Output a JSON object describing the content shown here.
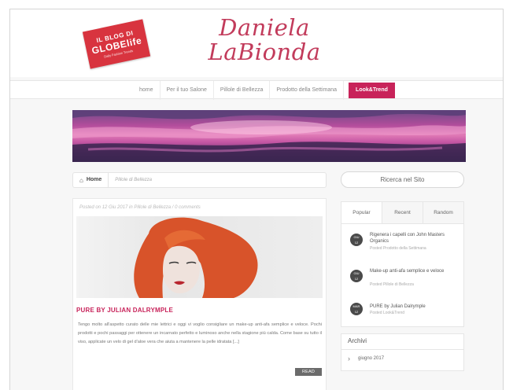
{
  "header": {
    "logo": {
      "line1": "IL BLOG DI",
      "line2": "GLOBElife",
      "line3": "Daily Fashion Trends"
    },
    "title_line1": "Daniela",
    "title_line2": "LaBionda"
  },
  "nav": {
    "items": [
      {
        "label": "home"
      },
      {
        "label": "Per il tuo Salone"
      },
      {
        "label": "Pillole di Bellezza"
      },
      {
        "label": "Prodotto della Settimana"
      },
      {
        "label": "Look&Trend",
        "active": true
      }
    ]
  },
  "breadcrumb": {
    "home": "Home",
    "current": "Pillole di Bellezza"
  },
  "search": {
    "label": "Ricerca nel Sito"
  },
  "post": {
    "meta": "Posted on 12 Giu 2017 in Pillole di Bellezza / 0 comments",
    "title": "PURE BY JULIAN DALRYMPLE",
    "excerpt": "Tengo molto all'aspetto curato delle mie lettrici e oggi vi voglio consigliare un make-up anti-afa semplice e veloce. Pochi prodotti e pochi passaggi per ottenere un incarnato perfetto e luminoso anche nella stagione più calda. Come base su tutto il viso, applicate un velo di gel d'aloe vera che aiuta a mantenere la pelle idratata [...]",
    "read_more": "READ MORE"
  },
  "sidebar": {
    "tabs": [
      {
        "label": "Popular"
      },
      {
        "label": "Recent"
      },
      {
        "label": "Random"
      }
    ],
    "items": [
      {
        "badge_month": "GIU",
        "badge_day": "12",
        "title": "Rigenera i capelli con John Masters Organics",
        "category": "Posted Prodotto della Settimana"
      },
      {
        "badge_month": "GIU",
        "badge_day": "12",
        "title": "Make-up anti-afa semplice e veloce",
        "category": "Posted Pillole di Bellezza"
      },
      {
        "badge_month": "MAR",
        "badge_day": "12",
        "title": "PURE by Julian Dalrymple",
        "category": "Posted Look&Trend"
      }
    ],
    "archive": {
      "title": "Archivi",
      "items": [
        {
          "label": "giugno 2017"
        }
      ]
    }
  },
  "colors": {
    "accent": "#c8235a",
    "title": "#c23b5b",
    "logo": "#d8343f"
  },
  "icons": {
    "home": "home-icon",
    "archive_chevron": "chevron-right-icon"
  }
}
